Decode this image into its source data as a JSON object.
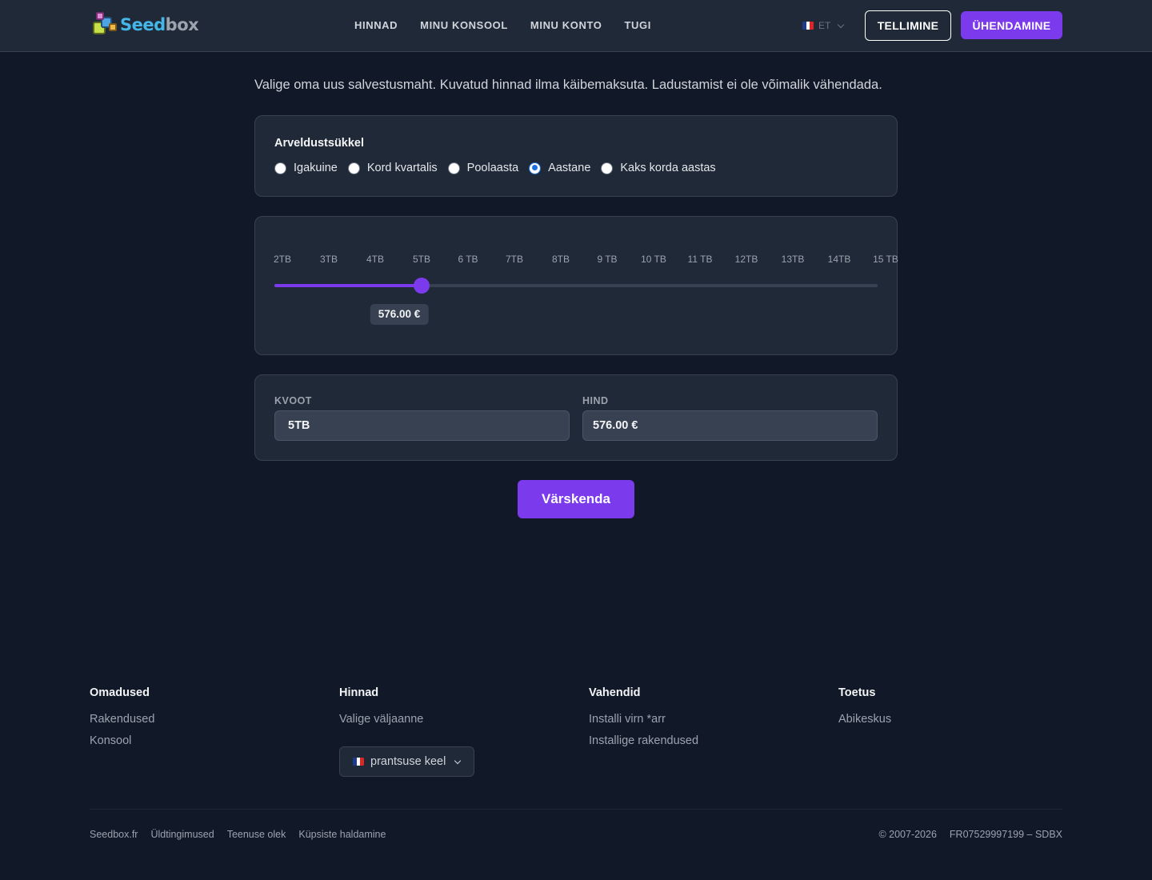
{
  "header": {
    "logo_text_a": "Seed",
    "logo_text_b": "box",
    "nav": [
      "HINNAD",
      "MINU KONSOOL",
      "MINU KONTO",
      "TUGI"
    ],
    "lang_code": "ET",
    "order_label": "TELLIMINE",
    "connect_label": "ÜHENDAMINE"
  },
  "main": {
    "intro": "Valige oma uus salvestusmaht. Kuvatud hinnad ilma käibemaksuta. Ladustamist ei ole võimalik vähendada.",
    "billing": {
      "title": "Arveldustsükkel",
      "options": [
        "Igakuine",
        "Kord kvartalis",
        "Poolaasta",
        "Aastane",
        "Kaks korda aastas"
      ],
      "selected": "Aastane"
    },
    "slider": {
      "ticks": [
        "2TB",
        "3TB",
        "4TB",
        "5TB",
        "6 TB",
        "7TB",
        "8TB",
        "9 TB",
        "10 TB",
        "11 TB",
        "12TB",
        "13TB",
        "14TB",
        "15 TB"
      ],
      "selected_index": 3,
      "price_bubble": "576.00 €"
    },
    "fields": {
      "quota_label": "KVOOT",
      "quota_value": "5TB",
      "price_label": "HIND",
      "price_value": "576.00 €"
    },
    "update_label": "Värskenda"
  },
  "footer": {
    "columns": [
      {
        "title": "Omadused",
        "links": [
          "Rakendused",
          "Konsool"
        ]
      },
      {
        "title": "Hinnad",
        "links": [
          "Valige väljaanne"
        ]
      },
      {
        "title": "Vahendid",
        "links": [
          "Installi virn *arr",
          "Installige rakendused"
        ]
      },
      {
        "title": "Toetus",
        "links": [
          "Abikeskus"
        ]
      }
    ],
    "language_select": "prantsuse keel",
    "bottom_links": [
      "Seedbox.fr",
      "Üldtingimused",
      "Teenuse olek",
      "Küpsiste haldamine"
    ],
    "copyright": "© 2007-2026",
    "company_id": "FR07529997199 – SDBX"
  },
  "colors": {
    "accent": "#7c3aed",
    "background": "#111827",
    "card": "#1f2937",
    "radio_selected": "#1d6fe0"
  }
}
